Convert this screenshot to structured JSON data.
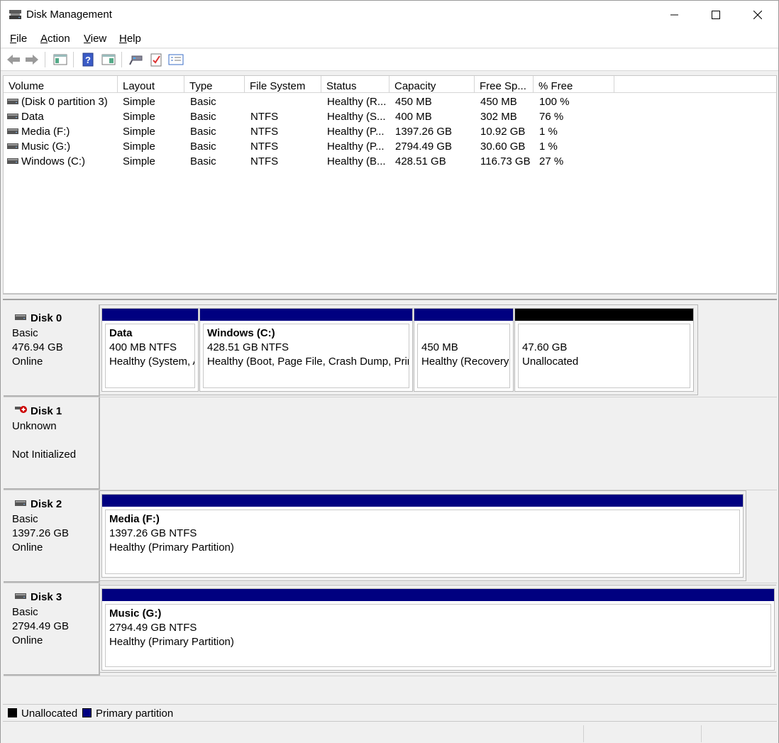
{
  "window": {
    "title": "Disk Management"
  },
  "menu": [
    {
      "label": "File",
      "mnemonic": "F",
      "rest": "ile"
    },
    {
      "label": "Action",
      "mnemonic": "A",
      "rest": "ction"
    },
    {
      "label": "View",
      "mnemonic": "V",
      "rest": "iew"
    },
    {
      "label": "Help",
      "mnemonic": "H",
      "rest": "elp"
    }
  ],
  "toolbar": {
    "icons": [
      "back-arrow-icon",
      "forward-arrow-icon",
      "show-hide-console-tree-icon",
      "help-icon",
      "properties-icon",
      "connect-icon",
      "check-icon",
      "settings-list-icon"
    ]
  },
  "volume_list": {
    "columns": [
      "Volume",
      "Layout",
      "Type",
      "File System",
      "Status",
      "Capacity",
      "Free Sp...",
      "% Free"
    ],
    "rows": [
      {
        "volume": "(Disk 0 partition 3)",
        "layout": "Simple",
        "type": "Basic",
        "fs": "",
        "status": "Healthy (R...",
        "capacity": "450 MB",
        "free": "450 MB",
        "pct": "100 %"
      },
      {
        "volume": "Data",
        "layout": "Simple",
        "type": "Basic",
        "fs": "NTFS",
        "status": "Healthy (S...",
        "capacity": "400 MB",
        "free": "302 MB",
        "pct": "76 %"
      },
      {
        "volume": "Media (F:)",
        "layout": "Simple",
        "type": "Basic",
        "fs": "NTFS",
        "status": "Healthy (P...",
        "capacity": "1397.26 GB",
        "free": "10.92 GB",
        "pct": "1 %"
      },
      {
        "volume": "Music (G:)",
        "layout": "Simple",
        "type": "Basic",
        "fs": "NTFS",
        "status": "Healthy (P...",
        "capacity": "2794.49 GB",
        "free": "30.60 GB",
        "pct": "1 %"
      },
      {
        "volume": "Windows (C:)",
        "layout": "Simple",
        "type": "Basic",
        "fs": "NTFS",
        "status": "Healthy (B...",
        "capacity": "428.51 GB",
        "free": "116.73 GB",
        "pct": "27 %"
      }
    ]
  },
  "disks": {
    "disk0": {
      "name": "Disk 0",
      "kind": "Basic",
      "size": "476.94 GB",
      "state": "Online",
      "partitions": [
        {
          "title": "Data",
          "line1": "400 MB NTFS",
          "line2": "Healthy (System, A"
        },
        {
          "title": "Windows  (C:)",
          "line1": "428.51 GB NTFS",
          "line2": "Healthy (Boot, Page File, Crash Dump, Prim"
        },
        {
          "title": "",
          "line1": "450 MB",
          "line2": "Healthy (Recovery"
        },
        {
          "title": "",
          "line1": "47.60 GB",
          "line2": "Unallocated"
        }
      ]
    },
    "disk1": {
      "name": "Disk 1",
      "kind": "Unknown",
      "state": "Not Initialized"
    },
    "disk2": {
      "name": "Disk 2",
      "kind": "Basic",
      "size": "1397.26 GB",
      "state": "Online",
      "partition": {
        "title": "Media  (F:)",
        "line1": "1397.26 GB NTFS",
        "line2": "Healthy (Primary Partition)"
      }
    },
    "disk3": {
      "name": "Disk 3",
      "kind": "Basic",
      "size": "2794.49 GB",
      "state": "Online",
      "partition": {
        "title": "Music  (G:)",
        "line1": "2794.49 GB NTFS",
        "line2": "Healthy (Primary Partition)"
      }
    }
  },
  "legend": {
    "unallocated": {
      "label": "Unallocated",
      "color": "#000000"
    },
    "primary": {
      "label": "Primary partition",
      "color": "#000080"
    }
  },
  "colors": {
    "primary_bar": "#000080",
    "unallocated_bar": "#000000"
  }
}
